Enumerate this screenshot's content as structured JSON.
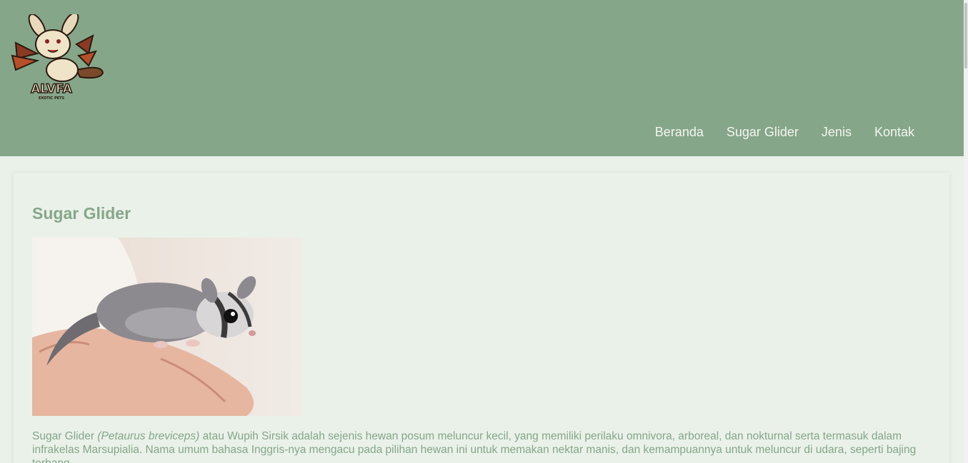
{
  "logo": {
    "text": "ALVFA",
    "subtext": "EXOTIC PETS"
  },
  "nav": {
    "items": [
      {
        "label": "Beranda"
      },
      {
        "label": "Sugar Glider"
      },
      {
        "label": "Jenis"
      },
      {
        "label": "Kontak"
      }
    ]
  },
  "main": {
    "title": "Sugar Glider",
    "image_alt": "sugar glider on hand",
    "description": {
      "lead": "Sugar Glider ",
      "scientific": "(Petaurus breviceps)",
      "body": " atau Wupih Sirsik adalah sejenis hewan posum meluncur kecil, yang memiliki perilaku omnivora, arboreal, dan nokturnal serta termasuk dalam infrakelas Marsupialia. Nama umum bahasa Inggris-nya mengacu pada pilihan hewan ini untuk memakan nektar manis, dan kemampuannya untuk meluncur di udara, seperti bajing terbang."
    }
  },
  "colors": {
    "header_bg": "#86a689",
    "page_bg": "#e9f1e8",
    "text": "#86a689",
    "nav_text": "#f3f6f0"
  }
}
